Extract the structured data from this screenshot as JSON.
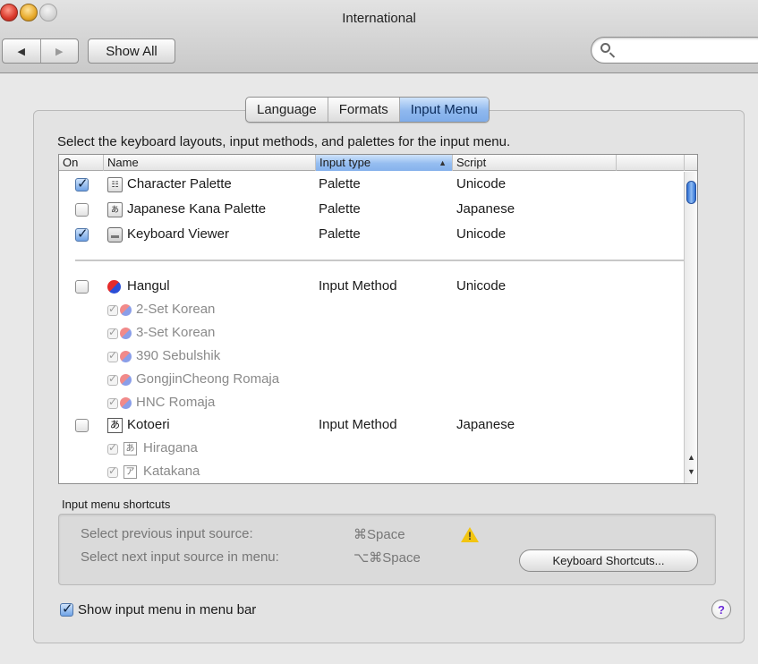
{
  "window": {
    "title": "International"
  },
  "toolbar": {
    "back": "◀",
    "forward": "▶",
    "show_all": "Show All",
    "search_placeholder": ""
  },
  "tabs": [
    {
      "label": "Language",
      "active": false
    },
    {
      "label": "Formats",
      "active": false
    },
    {
      "label": "Input Menu",
      "active": true
    }
  ],
  "instruction": "Select the keyboard layouts, input methods, and palettes for the input menu.",
  "table": {
    "columns": [
      "On",
      "Name",
      "Input type",
      "Script"
    ],
    "sorted_column": "Input type",
    "sort_arrow": "▲",
    "rows": [
      {
        "name": "Character Palette",
        "type": "Palette",
        "script": "Unicode",
        "checked": true,
        "icon": "character-palette-icon",
        "icon_glyph": "☷"
      },
      {
        "name": "Japanese Kana Palette",
        "type": "Palette",
        "script": "Japanese",
        "checked": false,
        "icon": "kana-palette-icon",
        "icon_glyph": "あ"
      },
      {
        "name": "Keyboard Viewer",
        "type": "Palette",
        "script": "Unicode",
        "checked": true,
        "icon": "keyboard-viewer-icon",
        "icon_glyph": ""
      },
      {
        "name": "Hangul",
        "type": "Input Method",
        "script": "Unicode",
        "checked": false,
        "icon": "hangul-flag-icon",
        "icon_glyph": ""
      },
      {
        "name": "2-Set Korean",
        "type": "",
        "script": "",
        "sub": true
      },
      {
        "name": "3-Set Korean",
        "type": "",
        "script": "",
        "sub": true
      },
      {
        "name": "390 Sebulshik",
        "type": "",
        "script": "",
        "sub": true
      },
      {
        "name": "GongjinCheong Romaja",
        "type": "",
        "script": "",
        "sub": true
      },
      {
        "name": "HNC Romaja",
        "type": "",
        "script": "",
        "sub": true
      },
      {
        "name": "Kotoeri",
        "type": "Input Method",
        "script": "Japanese",
        "checked": false,
        "icon": "kotoeri-icon",
        "icon_glyph": "あ"
      },
      {
        "name": "Hiragana",
        "type": "",
        "script": "",
        "sub": true,
        "icon_glyph": "あ"
      },
      {
        "name": "Katakana",
        "type": "",
        "script": "",
        "sub": true,
        "icon_glyph": "ア"
      }
    ]
  },
  "shortcuts": {
    "title": "Input menu shortcuts",
    "previous_label": "Select previous input source:",
    "previous_keys": "⌘Space",
    "next_label": "Select next input source in menu:",
    "next_keys": "⌥⌘Space",
    "button": "Keyboard Shortcuts..."
  },
  "show_in_menu_bar": {
    "label": "Show input menu in menu bar",
    "checked": true
  },
  "help": "?",
  "colors": {
    "accent": "#8fb8ee",
    "warning": "#f2c511",
    "help": "#6a2bd6"
  }
}
